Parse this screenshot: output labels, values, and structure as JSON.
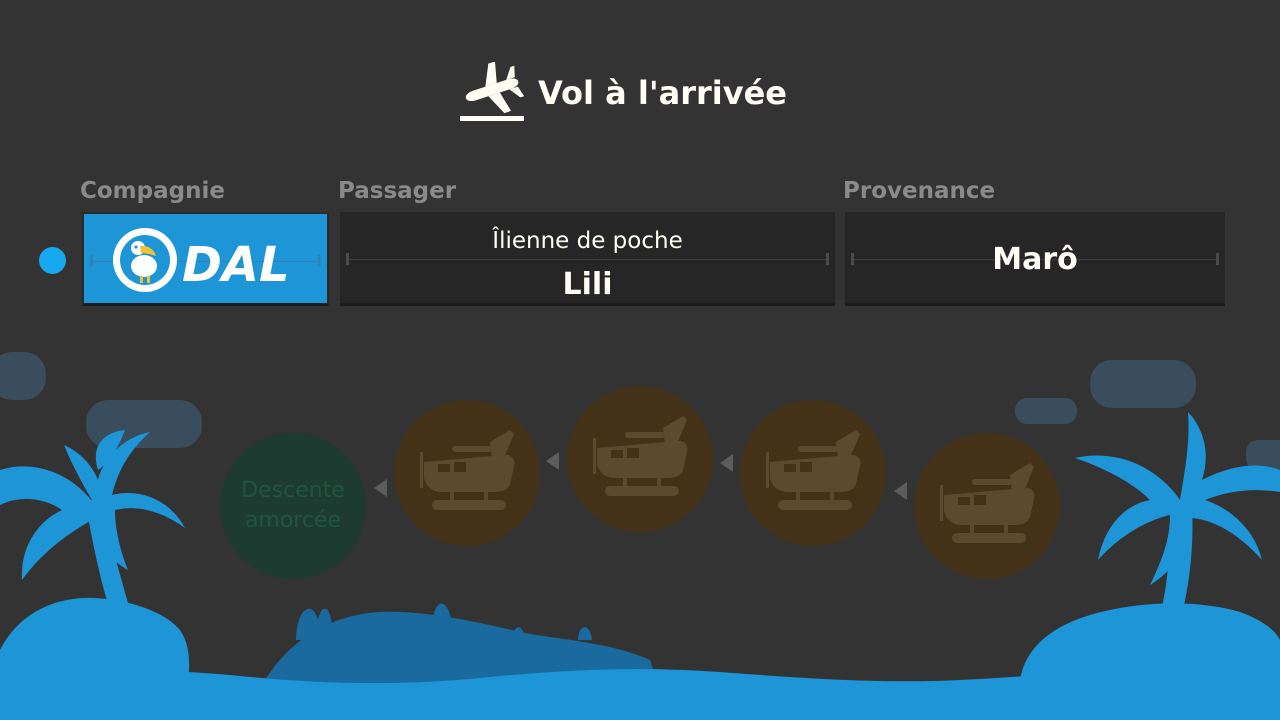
{
  "header": {
    "title": "Vol à l'arrivée",
    "icon": "plane-landing-icon"
  },
  "table": {
    "columns": {
      "company": "Compagnie",
      "passenger": "Passager",
      "origin": "Provenance"
    },
    "row": {
      "company_logo_text": "DAL",
      "passenger_title": "Îlienne de poche",
      "passenger_name": "Lili",
      "origin": "Marô"
    }
  },
  "progress": {
    "stages": [
      "seaplane",
      "seaplane",
      "seaplane",
      "seaplane"
    ],
    "final_stage_label_line1": "Descente",
    "final_stage_label_line2": "amorcée"
  },
  "colors": {
    "background": "#333333",
    "accent_blue": "#1d95d6",
    "indicator_dot": "#16a9ef",
    "stage_brown": "#433218",
    "stage_green": "#1d3b30"
  }
}
